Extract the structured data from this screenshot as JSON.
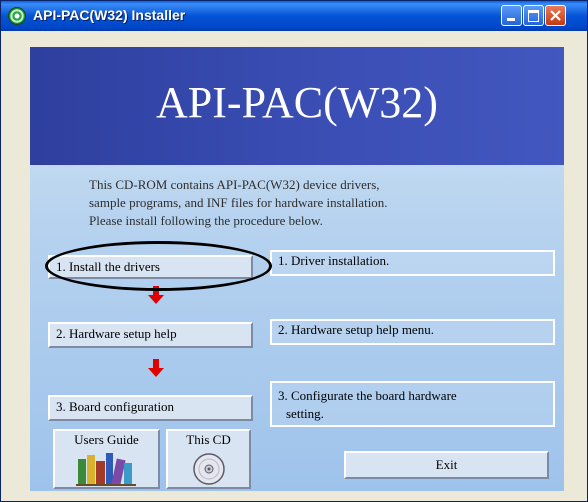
{
  "window": {
    "title": "API-PAC(W32) Installer"
  },
  "banner": {
    "title": "API-PAC(W32)"
  },
  "intro": {
    "line1": "This CD-ROM contains API-PAC(W32) device drivers,",
    "line2": "sample programs, and INF files for hardware installation.",
    "line3": "Please install following the procedure below."
  },
  "steps": [
    {
      "button": "1. Install the drivers",
      "description": "1. Driver installation."
    },
    {
      "button": "2. Hardware setup help",
      "description": "2. Hardware setup help menu."
    },
    {
      "button": "3. Board configuration",
      "description_line1": "3. Configurate the board hardware",
      "description_line2": "setting."
    }
  ],
  "bottom": {
    "users_guide": "Users Guide",
    "this_cd": "This CD",
    "exit": "Exit"
  },
  "icons": [
    "app-icon",
    "minimize-icon",
    "maximize-icon",
    "close-icon",
    "books-icon",
    "cd-disc-icon",
    "arrow-down-icon"
  ],
  "colors": {
    "titlebar": "#0553d6",
    "banner": "#3b4fb6",
    "arrow": "#e00000",
    "panel": "#b6d2ef"
  }
}
